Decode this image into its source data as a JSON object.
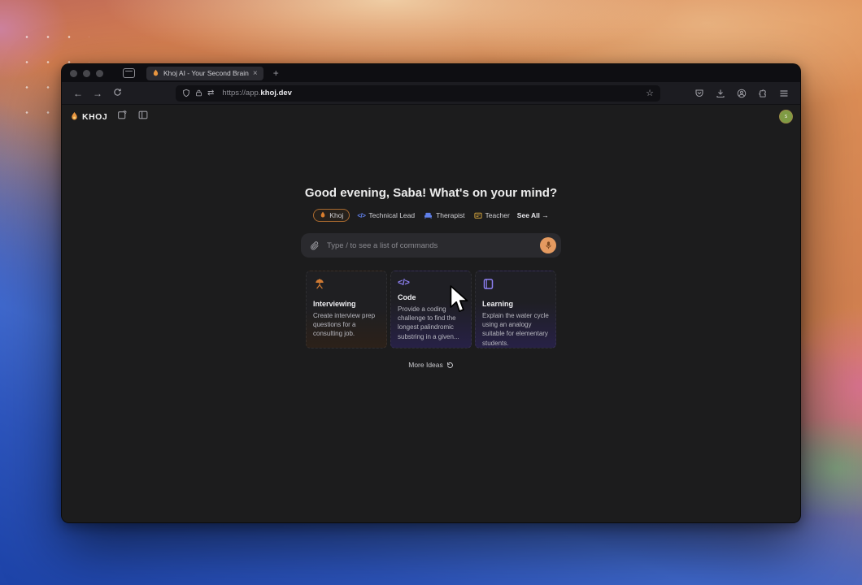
{
  "browser": {
    "tab": {
      "title": "Khoj AI - Your Second Brain",
      "close_glyph": "×"
    },
    "new_tab_glyph": "+",
    "nav": {
      "back_glyph": "←",
      "forward_glyph": "→"
    },
    "url": {
      "prefix": "https://app.",
      "domain": "khoj.dev",
      "swap_glyph": "⇄",
      "star_glyph": "☆"
    }
  },
  "app": {
    "brand": "KHOJ",
    "greeting": "Good evening, Saba! What's on your mind?",
    "agents": [
      {
        "label": "Khoj",
        "selected": true
      },
      {
        "label": "Technical Lead"
      },
      {
        "label": "Therapist"
      },
      {
        "label": "Teacher"
      }
    ],
    "see_all": "See All →",
    "input_placeholder": "Type / to see a list of commands",
    "cards": [
      {
        "title": "Interviewing",
        "body": "Create interview prep questions for a consulting job."
      },
      {
        "title": "Code",
        "body": "Provide a coding challenge to find the longest palindromic substring in a given..."
      },
      {
        "title": "Learning",
        "body": "Explain the water cycle using an analogy suitable for elementary students."
      }
    ],
    "more_ideas": "More Ideas",
    "avatar_glyph": "s"
  },
  "colors": {
    "accent_orange": "#d97e2e",
    "pill_blue": "#5f7fe8",
    "card_purple": "#8c7ff0",
    "avatar_green": "#7f9b44"
  }
}
